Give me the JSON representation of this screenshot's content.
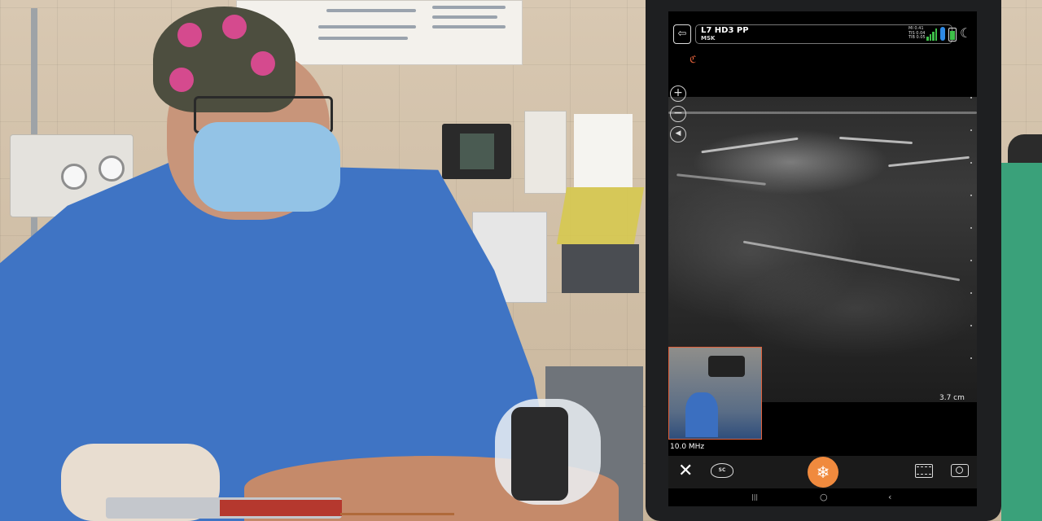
{
  "scene": {
    "description_labels": {
      "background": "operating-room-photo",
      "subject": "clinician-performing-ultrasound-guided-injection"
    }
  },
  "app": {
    "probe": {
      "name": "L7 HD3 PP",
      "preset": "MSK"
    },
    "indices": {
      "mi": "MI 0.41",
      "tis": "TIS 0.04",
      "tib": "TIB 0.05"
    },
    "signal_icon": "signal-bars-icon",
    "battery_icon": "battery-icon",
    "theme_icon": "moon-icon",
    "back_icon": "back-arrow-icon",
    "zoom_in_label": "+",
    "zoom_out_label": "−",
    "speaker_label": "◀",
    "depth_label": "3.7 cm",
    "frequency_label": "10.0 MHz",
    "bottom": {
      "close_label": "✕",
      "sc_label": "SC",
      "freeze_label": "❄"
    },
    "android_nav": {
      "recents": "|||",
      "home": "○",
      "back": "‹"
    },
    "colors": {
      "accent": "#f08a3e",
      "signal": "#3fc04a",
      "thermal": "#2e8ae6"
    }
  }
}
